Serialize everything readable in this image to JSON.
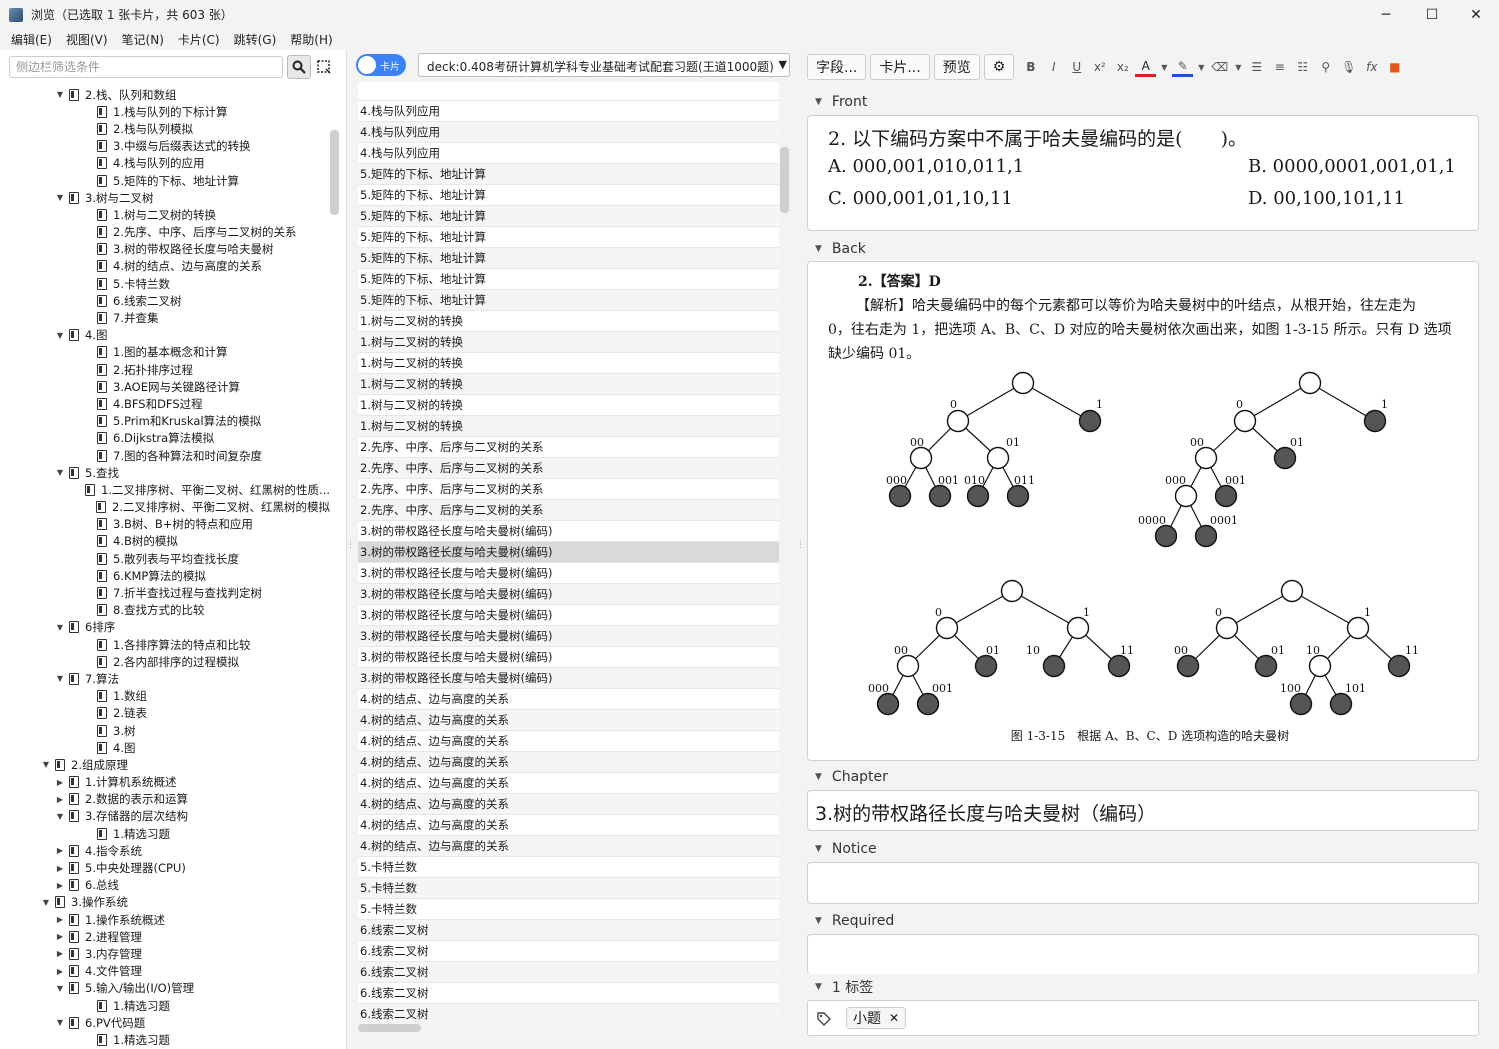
{
  "window": {
    "title": "浏览（已选取 1 张卡片，共 603 张）"
  },
  "menu": [
    "编辑(E)",
    "视图(V)",
    "笔记(N)",
    "卡片(C)",
    "跳转(G)",
    "帮助(H)"
  ],
  "sidebar": {
    "search_placeholder": "侧边栏筛选条件",
    "tree": [
      {
        "indent": 3,
        "arrow": "▼",
        "label": "2.栈、队列和数组"
      },
      {
        "indent": 5,
        "arrow": "",
        "label": "1.栈与队列的下标计算"
      },
      {
        "indent": 5,
        "arrow": "",
        "label": "2.栈与队列模拟"
      },
      {
        "indent": 5,
        "arrow": "",
        "label": "3.中缀与后缀表达式的转换"
      },
      {
        "indent": 5,
        "arrow": "",
        "label": "4.栈与队列的应用"
      },
      {
        "indent": 5,
        "arrow": "",
        "label": "5.矩阵的下标、地址计算"
      },
      {
        "indent": 3,
        "arrow": "▼",
        "label": "3.树与二叉树"
      },
      {
        "indent": 5,
        "arrow": "",
        "label": "1.树与二叉树的转换"
      },
      {
        "indent": 5,
        "arrow": "",
        "label": "2.先序、中序、后序与二叉树的关系"
      },
      {
        "indent": 5,
        "arrow": "",
        "label": "3.树的带权路径长度与哈夫曼树"
      },
      {
        "indent": 5,
        "arrow": "",
        "label": "4.树的结点、边与高度的关系"
      },
      {
        "indent": 5,
        "arrow": "",
        "label": "5.卡特兰数"
      },
      {
        "indent": 5,
        "arrow": "",
        "label": "6.线索二叉树"
      },
      {
        "indent": 5,
        "arrow": "",
        "label": "7.并查集"
      },
      {
        "indent": 3,
        "arrow": "▼",
        "label": "4.图"
      },
      {
        "indent": 5,
        "arrow": "",
        "label": "1.图的基本概念和计算"
      },
      {
        "indent": 5,
        "arrow": "",
        "label": "2.拓扑排序过程"
      },
      {
        "indent": 5,
        "arrow": "",
        "label": "3.AOE网与关键路径计算"
      },
      {
        "indent": 5,
        "arrow": "",
        "label": "4.BFS和DFS过程"
      },
      {
        "indent": 5,
        "arrow": "",
        "label": "5.Prim和Kruskal算法的模拟"
      },
      {
        "indent": 5,
        "arrow": "",
        "label": "6.Dijkstra算法模拟"
      },
      {
        "indent": 5,
        "arrow": "",
        "label": "7.图的各种算法和时间复杂度"
      },
      {
        "indent": 3,
        "arrow": "▼",
        "label": "5.查找"
      },
      {
        "indent": 5,
        "arrow": "",
        "label": "1.二叉排序树、平衡二叉树、红黑树的性质..."
      },
      {
        "indent": 5,
        "arrow": "",
        "label": "2.二叉排序树、平衡二叉树、红黑树的模拟"
      },
      {
        "indent": 5,
        "arrow": "",
        "label": "3.B树、B+树的特点和应用"
      },
      {
        "indent": 5,
        "arrow": "",
        "label": "4.B树的模拟"
      },
      {
        "indent": 5,
        "arrow": "",
        "label": "5.散列表与平均查找长度"
      },
      {
        "indent": 5,
        "arrow": "",
        "label": "6.KMP算法的模拟"
      },
      {
        "indent": 5,
        "arrow": "",
        "label": "7.折半查找过程与查找判定树"
      },
      {
        "indent": 5,
        "arrow": "",
        "label": "8.查找方式的比较"
      },
      {
        "indent": 3,
        "arrow": "▼",
        "label": "6排序"
      },
      {
        "indent": 5,
        "arrow": "",
        "label": "1.各排序算法的特点和比较"
      },
      {
        "indent": 5,
        "arrow": "",
        "label": "2.各内部排序的过程模拟"
      },
      {
        "indent": 3,
        "arrow": "▼",
        "label": "7.算法"
      },
      {
        "indent": 5,
        "arrow": "",
        "label": "1.数组"
      },
      {
        "indent": 5,
        "arrow": "",
        "label": "2.链表"
      },
      {
        "indent": 5,
        "arrow": "",
        "label": "3.树"
      },
      {
        "indent": 5,
        "arrow": "",
        "label": "4.图"
      },
      {
        "indent": 2,
        "arrow": "▼",
        "label": "2.组成原理"
      },
      {
        "indent": 3,
        "arrow": "▶",
        "label": "1.计算机系统概述"
      },
      {
        "indent": 3,
        "arrow": "▶",
        "label": "2.数据的表示和运算"
      },
      {
        "indent": 3,
        "arrow": "▼",
        "label": "3.存储器的层次结构"
      },
      {
        "indent": 5,
        "arrow": "",
        "label": "1.精选习题"
      },
      {
        "indent": 3,
        "arrow": "▶",
        "label": "4.指令系统"
      },
      {
        "indent": 3,
        "arrow": "▶",
        "label": "5.中央处理器(CPU)"
      },
      {
        "indent": 3,
        "arrow": "▶",
        "label": "6.总线"
      },
      {
        "indent": 2,
        "arrow": "▼",
        "label": "3.操作系统"
      },
      {
        "indent": 3,
        "arrow": "▶",
        "label": "1.操作系统概述"
      },
      {
        "indent": 3,
        "arrow": "▶",
        "label": "2.进程管理"
      },
      {
        "indent": 3,
        "arrow": "▶",
        "label": "3.内存管理"
      },
      {
        "indent": 3,
        "arrow": "▶",
        "label": "4.文件管理"
      },
      {
        "indent": 3,
        "arrow": "▼",
        "label": "5.输入/输出(I/O)管理"
      },
      {
        "indent": 5,
        "arrow": "",
        "label": "1.精选习题"
      },
      {
        "indent": 3,
        "arrow": "▼",
        "label": "6.PV代码题"
      },
      {
        "indent": 5,
        "arrow": "",
        "label": "1.精选习题"
      }
    ]
  },
  "browser": {
    "toggle_label": "卡片",
    "deck_search": "deck:0.408考研计算机学科专业基础考试配套习题(王道1000题)",
    "selected_index": 21,
    "rows": [
      "4.栈与队列应用",
      "4.栈与队列应用",
      "4.栈与队列应用",
      "5.矩阵的下标、地址计算",
      "5.矩阵的下标、地址计算",
      "5.矩阵的下标、地址计算",
      "5.矩阵的下标、地址计算",
      "5.矩阵的下标、地址计算",
      "5.矩阵的下标、地址计算",
      "5.矩阵的下标、地址计算",
      "1.树与二叉树的转换",
      "1.树与二叉树的转换",
      "1.树与二叉树的转换",
      "1.树与二叉树的转换",
      "1.树与二叉树的转换",
      "1.树与二叉树的转换",
      "2.先序、中序、后序与二叉树的关系",
      "2.先序、中序、后序与二叉树的关系",
      "2.先序、中序、后序与二叉树的关系",
      "2.先序、中序、后序与二叉树的关系",
      "3.树的带权路径长度与哈夫曼树(编码)",
      "3.树的带权路径长度与哈夫曼树(编码)",
      "3.树的带权路径长度与哈夫曼树(编码)",
      "3.树的带权路径长度与哈夫曼树(编码)",
      "3.树的带权路径长度与哈夫曼树(编码)",
      "3.树的带权路径长度与哈夫曼树(编码)",
      "3.树的带权路径长度与哈夫曼树(编码)",
      "3.树的带权路径长度与哈夫曼树(编码)",
      "4.树的结点、边与高度的关系",
      "4.树的结点、边与高度的关系",
      "4.树的结点、边与高度的关系",
      "4.树的结点、边与高度的关系",
      "4.树的结点、边与高度的关系",
      "4.树的结点、边与高度的关系",
      "4.树的结点、边与高度的关系",
      "4.树的结点、边与高度的关系",
      "5.卡特兰数",
      "5.卡特兰数",
      "5.卡特兰数",
      "6.线索二叉树",
      "6.线索二叉树",
      "6.线索二叉树",
      "6.线索二叉树",
      "6.线索二叉树"
    ]
  },
  "editor": {
    "toolbar": {
      "fields_label": "字段...",
      "cards_label": "卡片...",
      "preview_label": "预览"
    },
    "fields": {
      "front_label": "Front",
      "back_label": "Back",
      "chapter_label": "Chapter",
      "notice_label": "Notice",
      "required_label": "Required",
      "tags_label": "1 标签"
    },
    "front": {
      "question": "2. 以下编码方案中不属于哈夫曼编码的是(　　)。",
      "opt_a": "A. 000,001,010,011,1",
      "opt_b": "B. 0000,0001,001,01,1",
      "opt_c": "C. 000,001,01,10,11",
      "opt_d": "D. 00,100,101,11"
    },
    "back": {
      "answer": "2.【答案】D",
      "expl_1": "【解析】哈夫曼编码中的每个元素都可以等价为哈夫曼树中的叶结点，从根开始，往左走为",
      "expl_2": "0，往右走为 1，把选项 A、B、C、D 对应的哈夫曼树依次画出来，如图 1-3-15 所示。只有 D 选项",
      "expl_3": "缺少编码 01。",
      "caption": "图 1-3-15　根据 A、B、C、D 选项构造的哈夫曼树",
      "labels": {
        "a": [
          "0",
          "1",
          "00",
          "01",
          "000",
          "001",
          "010",
          "011"
        ],
        "b": [
          "0",
          "1",
          "00",
          "01",
          "000",
          "001",
          "0000",
          "0001"
        ],
        "c": [
          "0",
          "1",
          "00",
          "01",
          "10",
          "11",
          "000",
          "001"
        ],
        "d": [
          "0",
          "1",
          "00",
          "01",
          "10",
          "11",
          "100",
          "101"
        ]
      }
    },
    "chapter": "3.树的带权路径长度与哈夫曼树（编码）",
    "tag": "小题"
  },
  "colors": {
    "accent": "#3b82f6",
    "leaf": "#555555"
  }
}
